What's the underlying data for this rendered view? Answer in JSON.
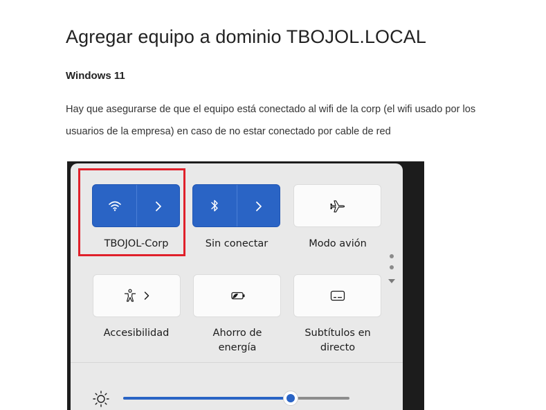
{
  "document": {
    "title": "Agregar equipo a dominio TBOJOL.LOCAL",
    "section_heading": "Windows 11",
    "paragraph": "Hay que asegurarse de que el equipo está conectado al wifi de la corp (el wifi usado por los usuarios de la empresa) en caso de no estar conectado por cable de red"
  },
  "quick_settings": {
    "tiles": [
      {
        "label": "TBOJOL-Corp",
        "icon": "wifi-icon",
        "active": true,
        "has_arrow": true
      },
      {
        "label": "Sin conectar",
        "icon": "bluetooth-icon",
        "active": true,
        "has_arrow": true
      },
      {
        "label": "Modo avión",
        "icon": "airplane-icon",
        "active": false,
        "has_arrow": false
      },
      {
        "label": "Accesibilidad",
        "icon": "accessibility-icon",
        "active": false,
        "has_arrow": true
      },
      {
        "label": "Ahorro de energía",
        "icon": "battery-saver-icon",
        "active": false,
        "has_arrow": false
      },
      {
        "label": "Subtítulos en directo",
        "icon": "live-captions-icon",
        "active": false,
        "has_arrow": false
      }
    ],
    "brightness": {
      "icon": "brightness-icon",
      "level": 0.74
    },
    "highlight_color": "#e0202a",
    "accent_color": "#2a64c5"
  }
}
